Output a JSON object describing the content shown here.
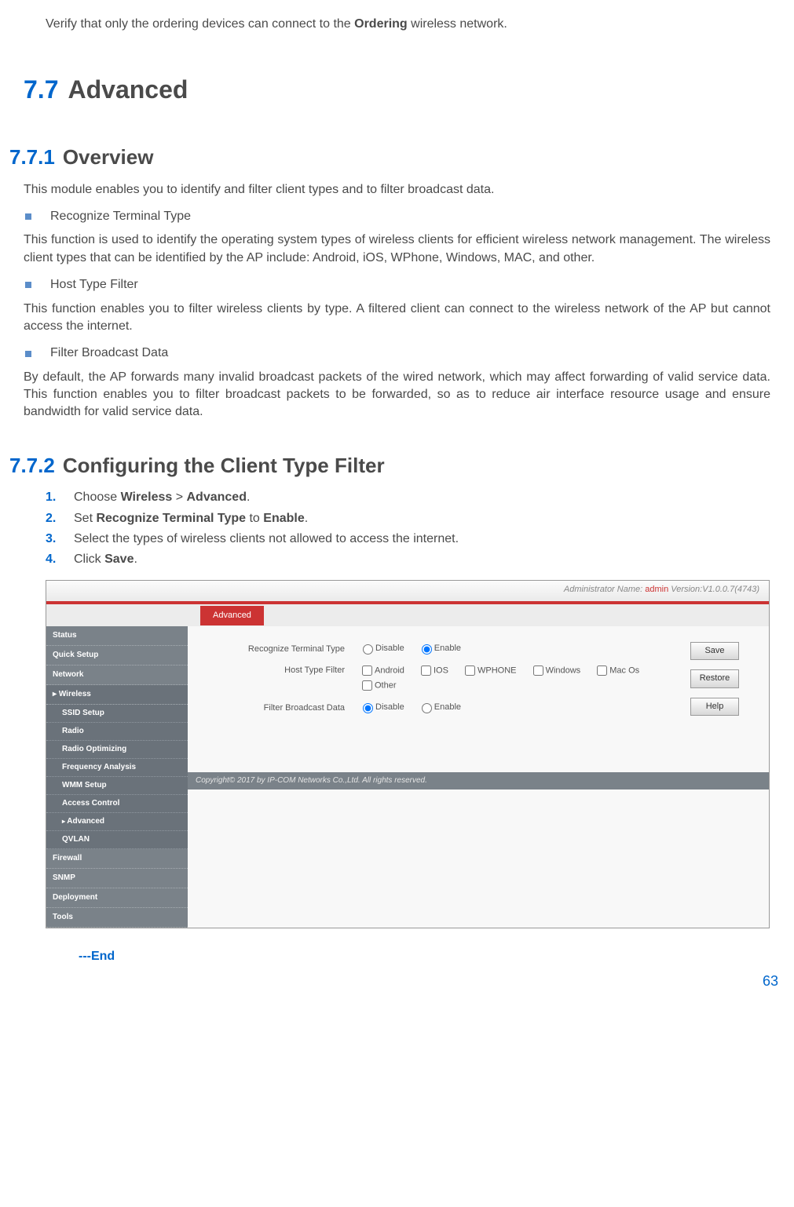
{
  "intro": {
    "verify_prefix": "Verify that only the ordering devices can connect to the ",
    "verify_bold": "Ordering",
    "verify_suffix": " wireless network."
  },
  "h77": {
    "num": "7.7",
    "title": "Advanced"
  },
  "h771": {
    "num": "7.7.1",
    "title": "Overview"
  },
  "overview": {
    "p1": "This module enables you to identify and filter client types and to filter broadcast data.",
    "b1": "Recognize Terminal Type",
    "p2": "This function is used to identify the operating system types of wireless clients for efficient wireless network management. The wireless client types that can be identified by the AP include: Android, iOS, WPhone, Windows, MAC, and other.",
    "b2": "Host Type Filter",
    "p3": "This function enables you to filter wireless clients by type. A filtered client can connect to the wireless network of the AP but cannot access the internet.",
    "b3": "Filter Broadcast Data",
    "p4": "By default, the AP forwards many invalid broadcast packets of the wired network, which may affect forwarding of valid service data. This function enables you to filter broadcast packets to be forwarded, so as to reduce air interface resource usage and ensure bandwidth for valid service data."
  },
  "h772": {
    "num": "7.7.2",
    "title": "Configuring the Client Type Filter"
  },
  "steps": {
    "s1": {
      "n": "1.",
      "pre": "Choose ",
      "b1": "Wireless",
      "mid": " > ",
      "b2": "Advanced",
      "post": "."
    },
    "s2": {
      "n": "2.",
      "pre": "Set ",
      "b1": "Recognize Terminal Type",
      "mid": " to ",
      "b2": "Enable",
      "post": "."
    },
    "s3": {
      "n": "3.",
      "text": "Select the types of wireless clients not allowed to access the internet."
    },
    "s4": {
      "n": "4.",
      "pre": "Click ",
      "b1": "Save",
      "post": "."
    }
  },
  "screenshot": {
    "top": {
      "label": "Administrator Name:",
      "admin": "admin",
      "version": "Version:V1.0.0.7(4743)"
    },
    "nav": {
      "status": "Status",
      "quick_setup": "Quick Setup",
      "network": "Network",
      "wireless": "Wireless",
      "ssid": "SSID Setup",
      "radio": "Radio",
      "radio_opt": "Radio Optimizing",
      "freq": "Frequency Analysis",
      "wmm": "WMM Setup",
      "access": "Access Control",
      "advanced": "Advanced",
      "qvlan": "QVLAN",
      "firewall": "Firewall",
      "snmp": "SNMP",
      "deployment": "Deployment",
      "tools": "Tools"
    },
    "tab": "Advanced",
    "form": {
      "row1_label": "Recognize Terminal Type",
      "disable": "Disable",
      "enable": "Enable",
      "row2_label": "Host Type Filter",
      "android": "Android",
      "ios": "IOS",
      "wphone": "WPHONE",
      "windows": "Windows",
      "macos": "Mac Os",
      "other": "Other",
      "row3_label": "Filter Broadcast Data"
    },
    "buttons": {
      "save": "Save",
      "restore": "Restore",
      "help": "Help"
    },
    "footer": "Copyright© 2017 by IP-COM Networks Co.,Ltd. All rights reserved."
  },
  "end": "---End",
  "page_num": "63"
}
